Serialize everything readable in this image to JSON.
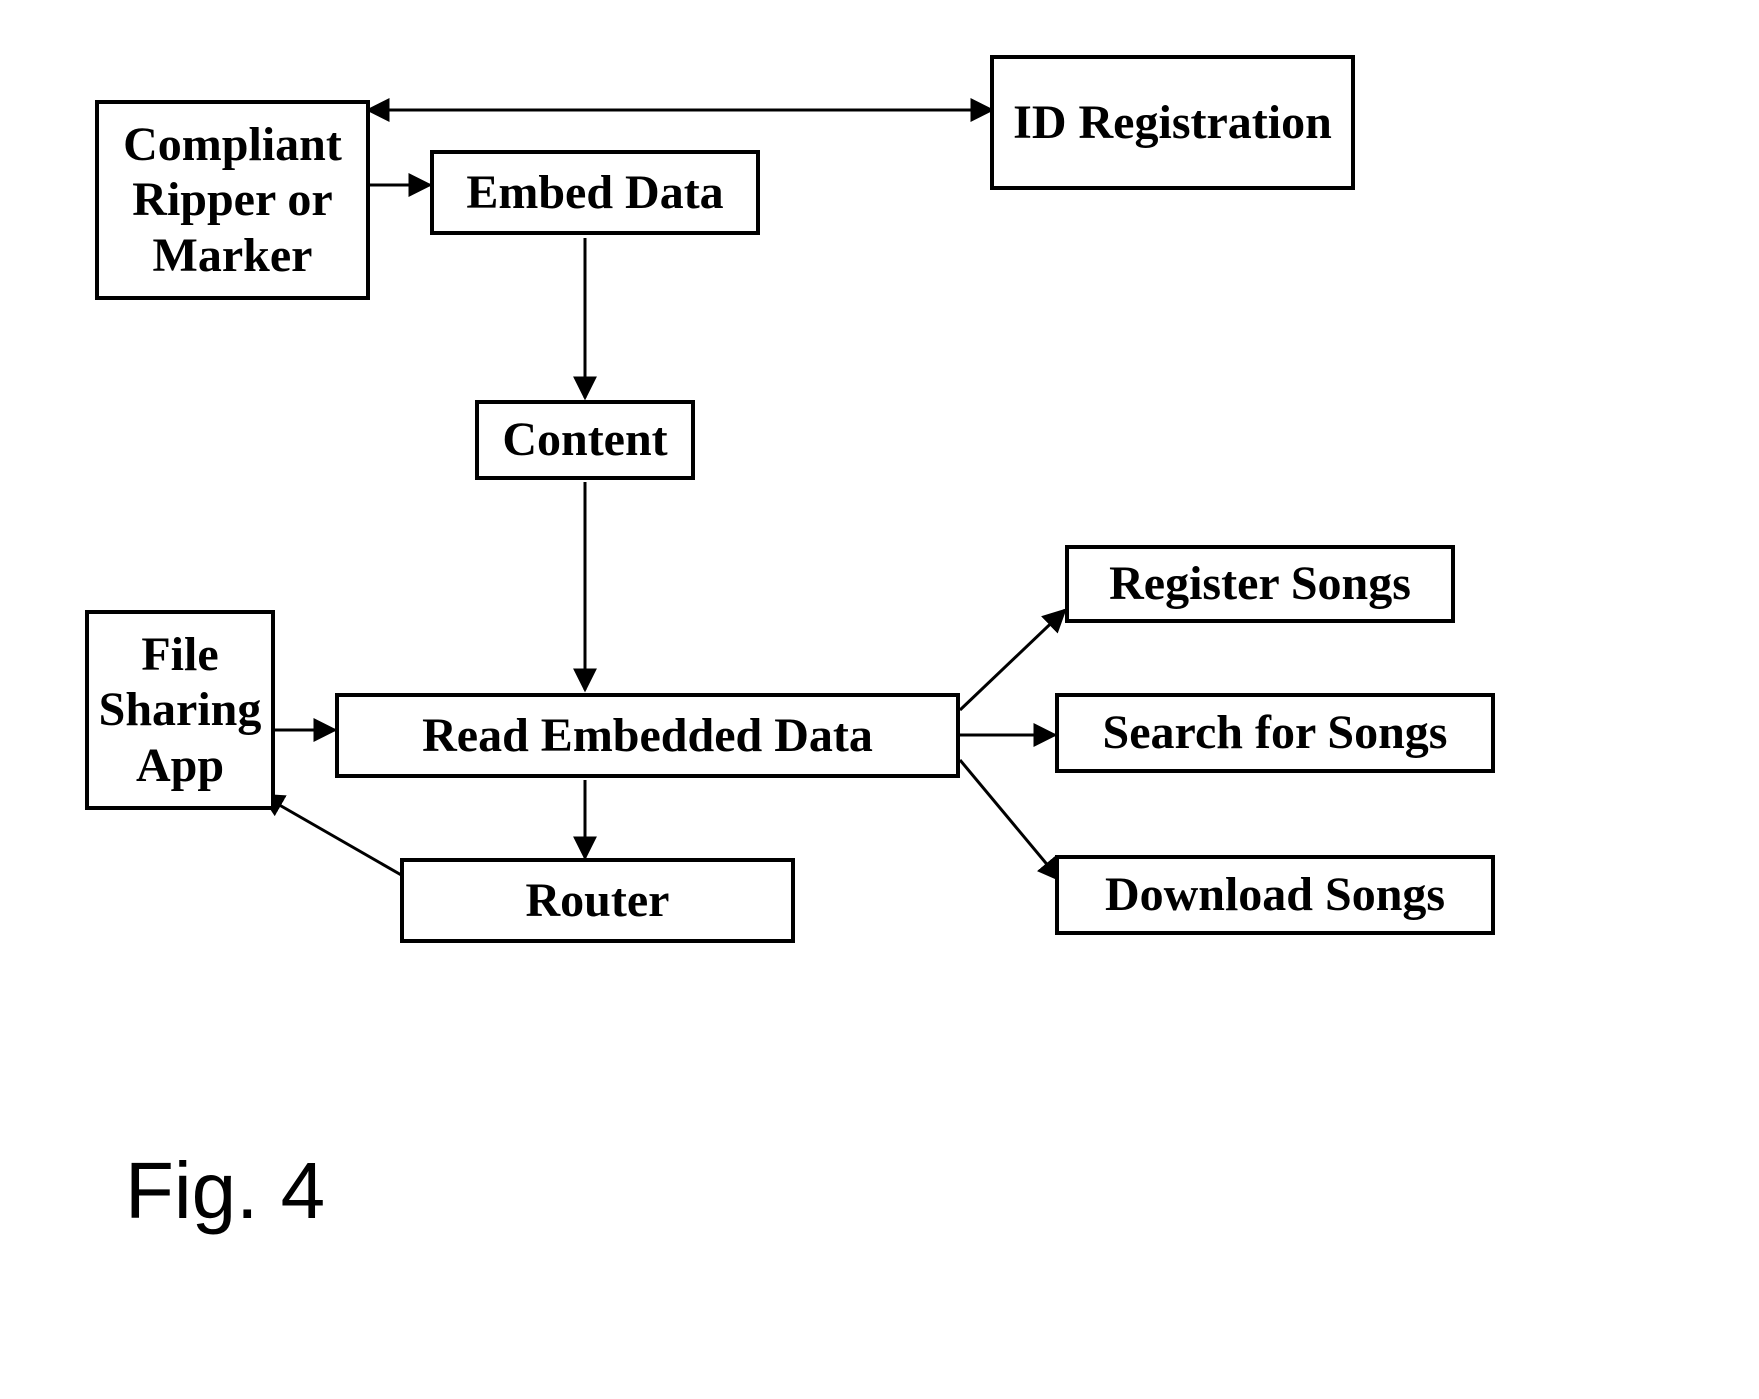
{
  "nodes": {
    "compliant": "Compliant Ripper or Marker",
    "idreg": "ID Registration",
    "embed": "Embed Data",
    "content": "Content",
    "filesharing": "File Sharing App",
    "read": "Read Embedded Data",
    "register": "Register Songs",
    "search": "Search for Songs",
    "download": "Download Songs",
    "router": "Router"
  },
  "caption": "Fig. 4"
}
